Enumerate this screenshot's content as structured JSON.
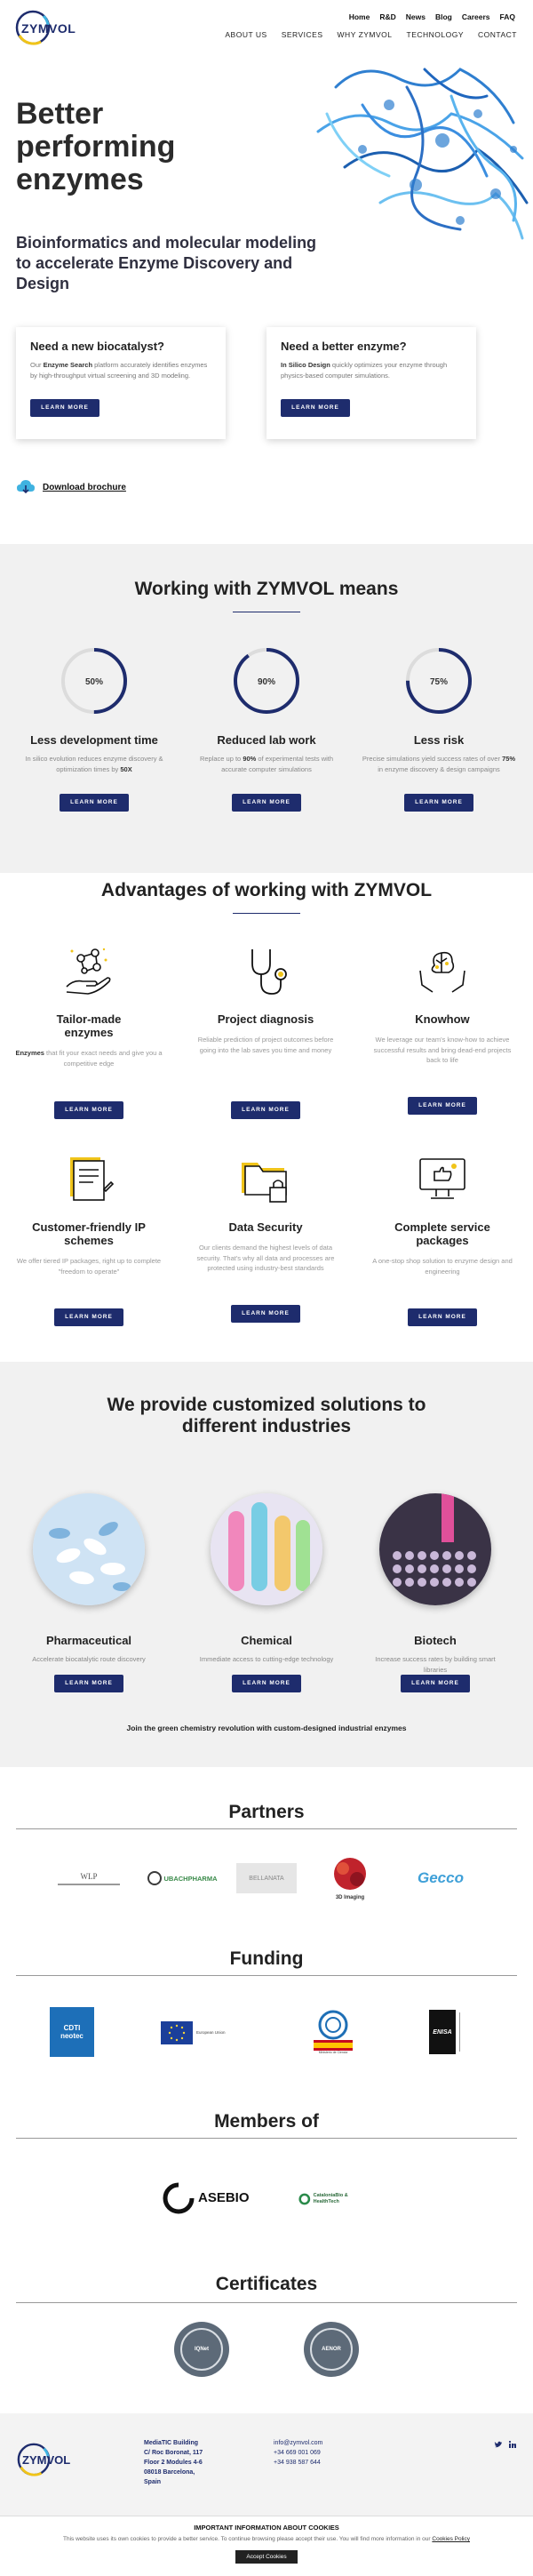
{
  "header": {
    "logo": "ZYMVOL",
    "top_nav": [
      "Home",
      "R&D",
      "News",
      "Blog",
      "Careers",
      "FAQ"
    ],
    "main_nav": [
      "ABOUT US",
      "SERVICES",
      "WHY ZYMVOL",
      "TECHNOLOGY",
      "CONTACT"
    ]
  },
  "hero": {
    "title": "Better performing enzymes",
    "subtitle": "Bioinformatics and molecular modeling to accelerate Enzyme Discovery and Design",
    "cards": [
      {
        "title": "Need a new biocatalyst?",
        "text_pre": "Our ",
        "text_bold": "Enzyme Search",
        "text_post": " platform accurately identifies enzymes by high-throughput virtual screening and 3D modeling.",
        "button": "LEARN MORE"
      },
      {
        "title": "Need a better enzyme?",
        "text_pre": "",
        "text_bold": "In Silico Design",
        "text_post": " quickly optimizes your enzyme through physics-based computer simulations.",
        "button": "LEARN MORE"
      }
    ],
    "download": "Download brochure"
  },
  "working": {
    "title": "Working with ZYMVOL means",
    "items": [
      {
        "percent": "50%",
        "fraction": 0.5,
        "title": "Less development time",
        "text_pre": "In silico evolution reduces enzyme discovery & optimization times by ",
        "text_bold": "50X",
        "text_post": "",
        "button": "LEARN MORE"
      },
      {
        "percent": "90%",
        "fraction": 0.9,
        "title": "Reduced lab work",
        "text_pre": "Replace up to ",
        "text_bold": "90%",
        "text_post": " of experimental tests with accurate computer simulations",
        "button": "LEARN MORE"
      },
      {
        "percent": "75%",
        "fraction": 0.75,
        "title": "Less risk",
        "text_pre": "Precise simulations yield success rates of over ",
        "text_bold": "75%",
        "text_post": " in enzyme discovery & design campaigns",
        "button": "LEARN MORE"
      }
    ]
  },
  "advantages": {
    "title": "Advantages of working with  ZYMVOL",
    "items": [
      {
        "title": "Tailor-made enzymes",
        "text_bold": "Enzymes",
        "text": " that fit your exact needs and give you a competitive edge",
        "button": "LEARN MORE"
      },
      {
        "title": "Project diagnosis",
        "text_bold": "",
        "text": "Reliable prediction of project outcomes before going into the lab saves you time and money",
        "button": "LEARN MORE"
      },
      {
        "title": "Knowhow",
        "text_bold": "",
        "text": "We leverage our team's know-how to achieve successful results and bring dead-end projects back to life",
        "button": "LEARN MORE"
      },
      {
        "title": "Customer-friendly IP schemes",
        "text_bold": "",
        "text": "We offer tiered IP packages, right up to complete \"freedom to operate\"",
        "button": "LEARN MORE"
      },
      {
        "title": "Data Security",
        "text_bold": "",
        "text": "Our clients demand the highest levels of data security. That's why all data and processes are protected using industry-best standards",
        "button": "LEARN MORE"
      },
      {
        "title": "Complete service packages",
        "text_bold": "",
        "text": "A one-stop shop solution to enzyme design and engineering",
        "button": "LEARN MORE"
      }
    ]
  },
  "industries": {
    "title": "We provide customized solutions to different industries",
    "items": [
      {
        "title": "Pharmaceutical",
        "text": "Accelerate biocatalytic route discovery",
        "button": "LEARN MORE"
      },
      {
        "title": "Chemical",
        "text": "Immediate access to cutting-edge technology",
        "button": "LEARN MORE"
      },
      {
        "title": "Biotech",
        "text": "Increase success rates by building smart libraries",
        "button": "LEARN MORE"
      }
    ],
    "tagline": "Join the green chemistry revolution with custom-designed industrial enzymes"
  },
  "partners": {
    "title": "Partners",
    "logos": [
      "WLP",
      "UBACHPHARMA",
      "BELLANATA",
      "3D Imaging",
      "Gecco"
    ]
  },
  "funding": {
    "title": "Funding",
    "logos": [
      "CDTI neotec",
      "European Union",
      "Ministerio de Ciencia",
      "ENISA"
    ]
  },
  "members": {
    "title": "Members of",
    "logos": [
      "ASEBIO",
      "CataloniaBio & HealthTech"
    ]
  },
  "certificates": {
    "title": "Certificates",
    "logos": [
      "IQNet",
      "AENOR"
    ]
  },
  "footer": {
    "address": [
      "MediaTIC Building",
      "C/ Roc Boronat, 117",
      "Floor 2 Modules 4-6",
      "08018 Barcelona,",
      "Spain"
    ],
    "contact": [
      "info@zymvol.com",
      "+34 669 001 069",
      "+34 938 587 644"
    ]
  },
  "cookie": {
    "title": "IMPORTANT INFORMATION ABOUT COOKIES",
    "text": "This website uses its own cookies to provide a better service. To continue browsing please accept their use. You will find more information in our",
    "link": "Cookies Policy",
    "button": "Accept Cookies"
  }
}
